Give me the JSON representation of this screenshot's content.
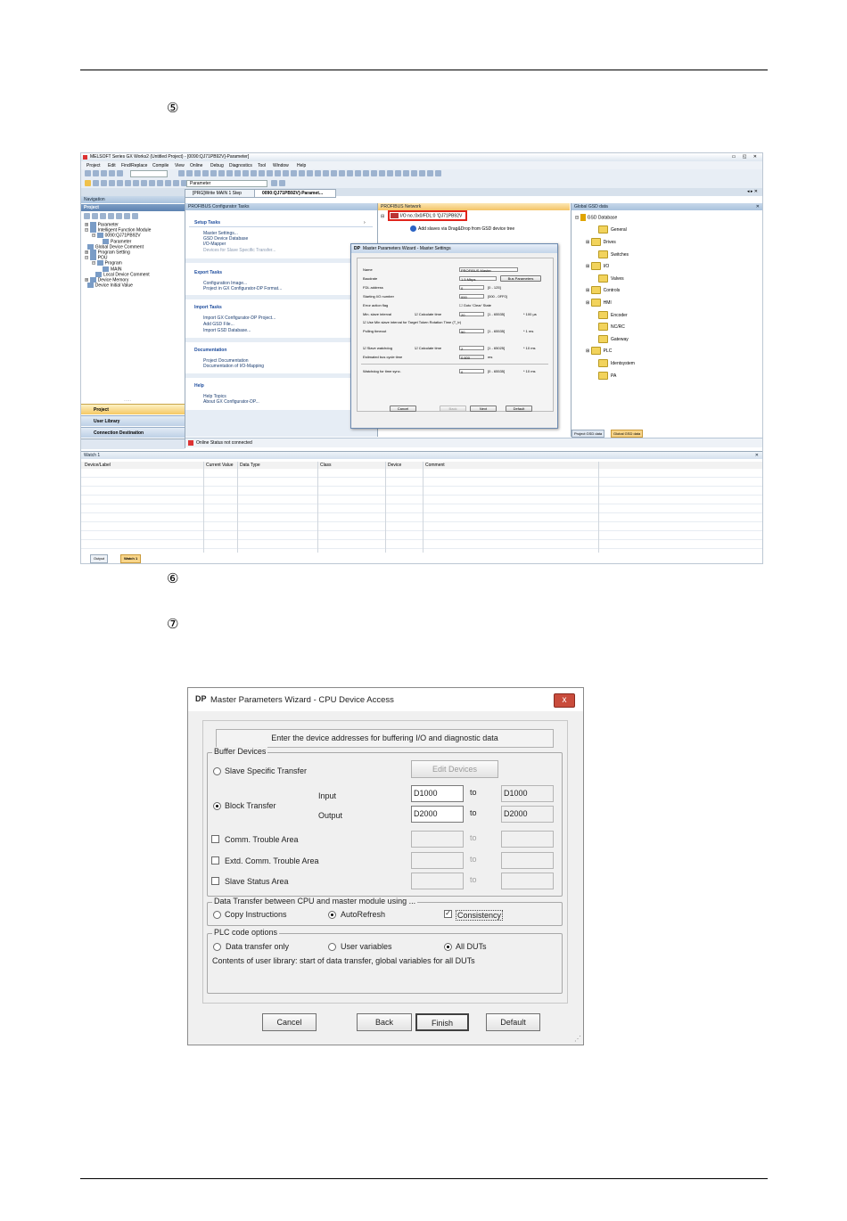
{
  "page": {
    "step_5_marker": "⑤",
    "step_6_marker": "⑥",
    "step_7_marker": "⑦"
  },
  "app": {
    "window_title": "MELSOFT Series GX Works2 (Untitled Project) - [0090:QJ71PB92V]-Parameter]",
    "menus": [
      "Project",
      "Edit",
      "Find/Replace",
      "Compile",
      "View",
      "Online",
      "Debug",
      "Diagnostics",
      "Tool",
      "Window",
      "Help"
    ],
    "toolbar_combo": "Parameter",
    "tabs": [
      "[PRG]Write MAIN 1 Step",
      "0090:QJ71PB92V]-Paramet..."
    ],
    "navigation_title": "Navigation",
    "project_header": "Project",
    "tree": [
      "Parameter",
      "Intelligent Function Module",
      "0090:QJ71PB92V",
      "Parameter",
      "Global Device Comment",
      "Program Setting",
      "POU",
      "Program",
      "MAIN",
      "Local Device Comment",
      "Device Memory",
      "Device Initial Value"
    ],
    "nav_buttons": [
      "Project",
      "User Library",
      "Connection Destination"
    ],
    "configurator_title": "PROFIBUS Configurator Tasks",
    "setup_tasks_header": "Setup Tasks",
    "setup_tasks": [
      "Master Settings...",
      "GSD Device Database",
      "I/O-Mapper",
      "Devices for Slave Specific Transfer..."
    ],
    "export_tasks_header": "Export Tasks",
    "export_tasks": [
      "Configuration Image...",
      "Project in GX Configurator-DP Format..."
    ],
    "import_tasks_header": "Import Tasks",
    "import_tasks": [
      "Import GX Configurator-DP Project...",
      "Add GSD File...",
      "Import GSD Database..."
    ],
    "documentation_header": "Documentation",
    "documentation_items": [
      "Project Documentation",
      "Documentation of I/O-Mapping"
    ],
    "help_header": "Help",
    "help_items": [
      "Help Topics",
      "About GX Configurator-DP..."
    ],
    "network_title": "PROFIBUS Network",
    "network_node": "I/O no.:0x0/FDL:0 'QJ71PB92V",
    "network_hint": "Add slaves via Drag&Drop from GSD device tree",
    "gsd_title": "Global GSD data",
    "gsd_root": "GSD Database",
    "gsd_items": [
      "General",
      "Drives",
      "Switches",
      "I/O",
      "Valves",
      "Controls",
      "HMI",
      "Encoder",
      "NC/RC",
      "Gateway",
      "PLC",
      "Identsystem",
      "PA"
    ],
    "gsd_tabs": [
      "Project GSD data",
      "Global GSD data"
    ],
    "status_text": "Online Status not connected",
    "watch_title": "Watch 1",
    "watch_columns": [
      "Device/Label",
      "Current Value",
      "Data Type",
      "Class",
      "Device",
      "Comment"
    ],
    "bottom_tabs": [
      "Output",
      "Watch 1"
    ]
  },
  "small_wizard": {
    "title": "Master Parameters Wizard - Master Settings",
    "fields": [
      {
        "label": "Name",
        "value": "PROFIBUS Master"
      },
      {
        "label": "Baudrate",
        "value": "1.5 Mbps"
      },
      {
        "label": "FDL address",
        "value": "0",
        "range": "[0 - 125]"
      },
      {
        "label": "Starting I/O number",
        "value": "000",
        "range": "[000 - 0FF0]"
      },
      {
        "label": "Error action flag",
        "check": "Goto 'Clear' State"
      },
      {
        "label": "Min. slave interval",
        "check": "Calculate time",
        "value": "20",
        "range": "[1 - 65535]",
        "unit": "* 100 µs"
      },
      {
        "label": "Use Min slave interval for Target Token Rotation Time (T_tr)"
      },
      {
        "label": "Polling timeout",
        "value": "50",
        "range": "[1 - 65535]",
        "unit": "* 1 ms"
      },
      {
        "label": "Slave watchdog",
        "check": "Calculate time",
        "value": "2",
        "range": "[1 - 65025]",
        "unit": "* 10 ms"
      },
      {
        "label": "Estimated bus cycle time",
        "value": "0.600",
        "unit": "ms"
      },
      {
        "label": "Watchdog for time sync.",
        "value": "0",
        "range": "[0 - 65535]",
        "unit": "* 10 ms"
      }
    ],
    "bus_parameters_button": "Bus Parameters",
    "buttons": [
      "Cancel",
      "Back",
      "Next",
      "Default"
    ]
  },
  "dialog": {
    "title": "Master Parameters Wizard - CPU Device Access",
    "close_label": "x",
    "instruction": "Enter the device addresses for buffering I/O and diagnostic data",
    "buffer_group": "Buffer Devices",
    "slave_specific": "Slave Specific Transfer",
    "edit_devices": "Edit Devices",
    "block_transfer": "Block Transfer",
    "input_label": "Input",
    "output_label": "Output",
    "to_label": "to",
    "input_from": "D1000",
    "input_to": "D1000",
    "output_from": "D2000",
    "output_to": "D2000",
    "comm_trouble": "Comm. Trouble Area",
    "extd_comm_trouble": "Extd. Comm. Trouble Area",
    "slave_status": "Slave Status Area",
    "transfer_group": "Data Transfer between CPU and master module using ...",
    "copy_instructions": "Copy Instructions",
    "autorefresh": "AutoRefresh",
    "consistency": "Consistency",
    "plc_group": "PLC code options",
    "data_transfer_only": "Data transfer only",
    "user_variables": "User variables",
    "all_duts": "All DUTs",
    "plc_description": "Contents of user library: start of data transfer, global variables for all DUTs",
    "cancel": "Cancel",
    "back": "Back",
    "finish": "Finish",
    "default": "Default"
  },
  "colors": {
    "accent": "#1c4b9c",
    "highlight_box": "#e0241b",
    "title_bar": "#c3d4e9"
  }
}
